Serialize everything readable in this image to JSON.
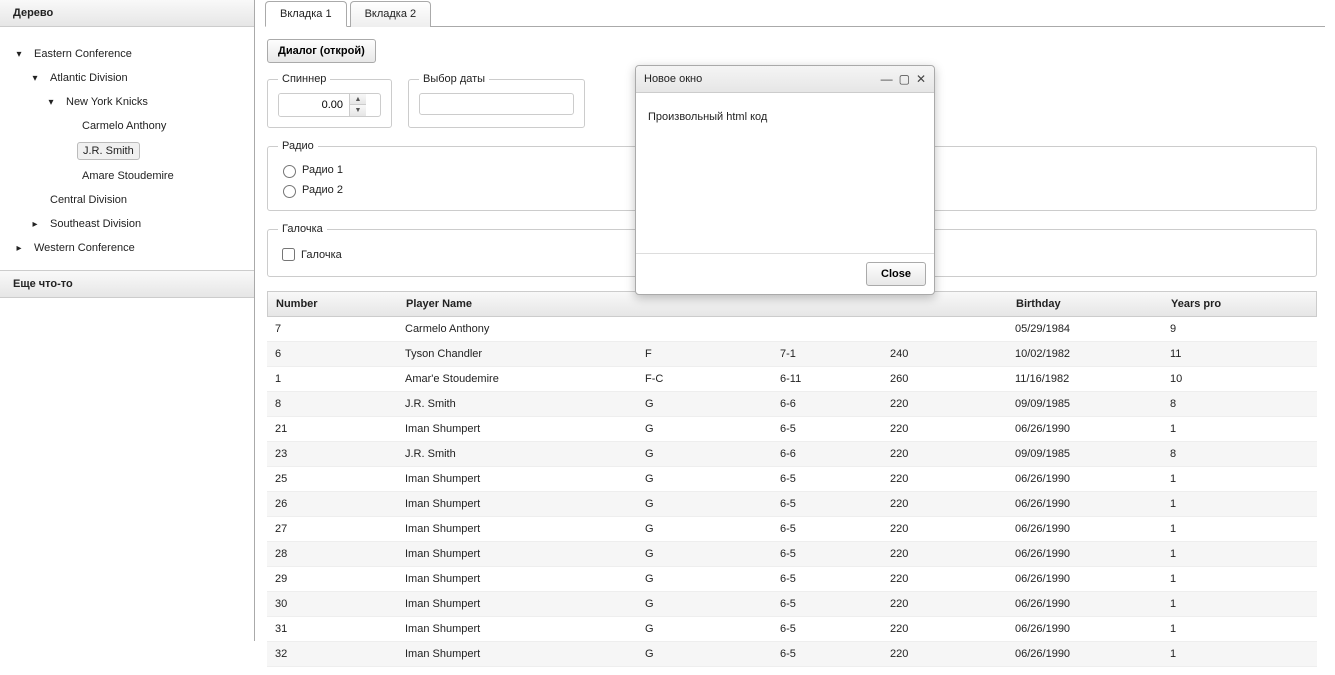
{
  "sidebar": {
    "header1": "Дерево",
    "header2": "Еще что-то",
    "tree": [
      {
        "label": "Eastern Conference",
        "depth": 1,
        "expanded": true,
        "hasChildren": true
      },
      {
        "label": "Atlantic Division",
        "depth": 2,
        "expanded": true,
        "hasChildren": true
      },
      {
        "label": "New York Knicks",
        "depth": 3,
        "expanded": true,
        "hasChildren": true
      },
      {
        "label": "Carmelo Anthony",
        "depth": 4,
        "expanded": false,
        "hasChildren": false
      },
      {
        "label": "J.R. Smith",
        "depth": 4,
        "expanded": false,
        "hasChildren": false,
        "selected": true
      },
      {
        "label": "Amare Stoudemire",
        "depth": 4,
        "expanded": false,
        "hasChildren": false
      },
      {
        "label": "Central Division",
        "depth": 2,
        "expanded": false,
        "hasChildren": false
      },
      {
        "label": "Southeast Division",
        "depth": 2,
        "expanded": false,
        "hasChildren": true
      },
      {
        "label": "Western Conference",
        "depth": 1,
        "expanded": false,
        "hasChildren": true
      }
    ]
  },
  "tabs": [
    "Вкладка 1",
    "Вкладка 2"
  ],
  "activeTab": 0,
  "dialogButton": "Диалог (открой)",
  "spinner": {
    "legend": "Спиннер",
    "value": "0.00"
  },
  "datepicker": {
    "legend": "Выбор даты",
    "value": ""
  },
  "radio": {
    "legend": "Радио",
    "options": [
      "Радио 1",
      "Радио 2"
    ]
  },
  "checkbox": {
    "legend": "Галочка",
    "label": "Галочка"
  },
  "table": {
    "headers": [
      "Number",
      "Player Name",
      "",
      "",
      "",
      "Birthday",
      "Years pro"
    ],
    "rows": [
      {
        "num": "7",
        "name": "Carmelo Anthony",
        "pos": "",
        "h": "",
        "w": "",
        "bday": "05/29/1984",
        "yrs": "9"
      },
      {
        "num": "6",
        "name": "Tyson Chandler",
        "pos": "F",
        "h": "7-1",
        "w": "240",
        "bday": "10/02/1982",
        "yrs": "11"
      },
      {
        "num": "1",
        "name": "Amar'e Stoudemire",
        "pos": "F-C",
        "h": "6-11",
        "w": "260",
        "bday": "11/16/1982",
        "yrs": "10"
      },
      {
        "num": "8",
        "name": "J.R. Smith",
        "pos": "G",
        "h": "6-6",
        "w": "220",
        "bday": "09/09/1985",
        "yrs": "8"
      },
      {
        "num": "21",
        "name": "Iman Shumpert",
        "pos": "G",
        "h": "6-5",
        "w": "220",
        "bday": "06/26/1990",
        "yrs": "1"
      },
      {
        "num": "23",
        "name": "J.R. Smith",
        "pos": "G",
        "h": "6-6",
        "w": "220",
        "bday": "09/09/1985",
        "yrs": "8"
      },
      {
        "num": "25",
        "name": "Iman Shumpert",
        "pos": "G",
        "h": "6-5",
        "w": "220",
        "bday": "06/26/1990",
        "yrs": "1"
      },
      {
        "num": "26",
        "name": "Iman Shumpert",
        "pos": "G",
        "h": "6-5",
        "w": "220",
        "bday": "06/26/1990",
        "yrs": "1"
      },
      {
        "num": "27",
        "name": "Iman Shumpert",
        "pos": "G",
        "h": "6-5",
        "w": "220",
        "bday": "06/26/1990",
        "yrs": "1"
      },
      {
        "num": "28",
        "name": "Iman Shumpert",
        "pos": "G",
        "h": "6-5",
        "w": "220",
        "bday": "06/26/1990",
        "yrs": "1"
      },
      {
        "num": "29",
        "name": "Iman Shumpert",
        "pos": "G",
        "h": "6-5",
        "w": "220",
        "bday": "06/26/1990",
        "yrs": "1"
      },
      {
        "num": "30",
        "name": "Iman Shumpert",
        "pos": "G",
        "h": "6-5",
        "w": "220",
        "bday": "06/26/1990",
        "yrs": "1"
      },
      {
        "num": "31",
        "name": "Iman Shumpert",
        "pos": "G",
        "h": "6-5",
        "w": "220",
        "bday": "06/26/1990",
        "yrs": "1"
      },
      {
        "num": "32",
        "name": "Iman Shumpert",
        "pos": "G",
        "h": "6-5",
        "w": "220",
        "bday": "06/26/1990",
        "yrs": "1"
      }
    ]
  },
  "dialog": {
    "title": "Новое окно",
    "body": "Произвольный html код",
    "close": "Close"
  }
}
